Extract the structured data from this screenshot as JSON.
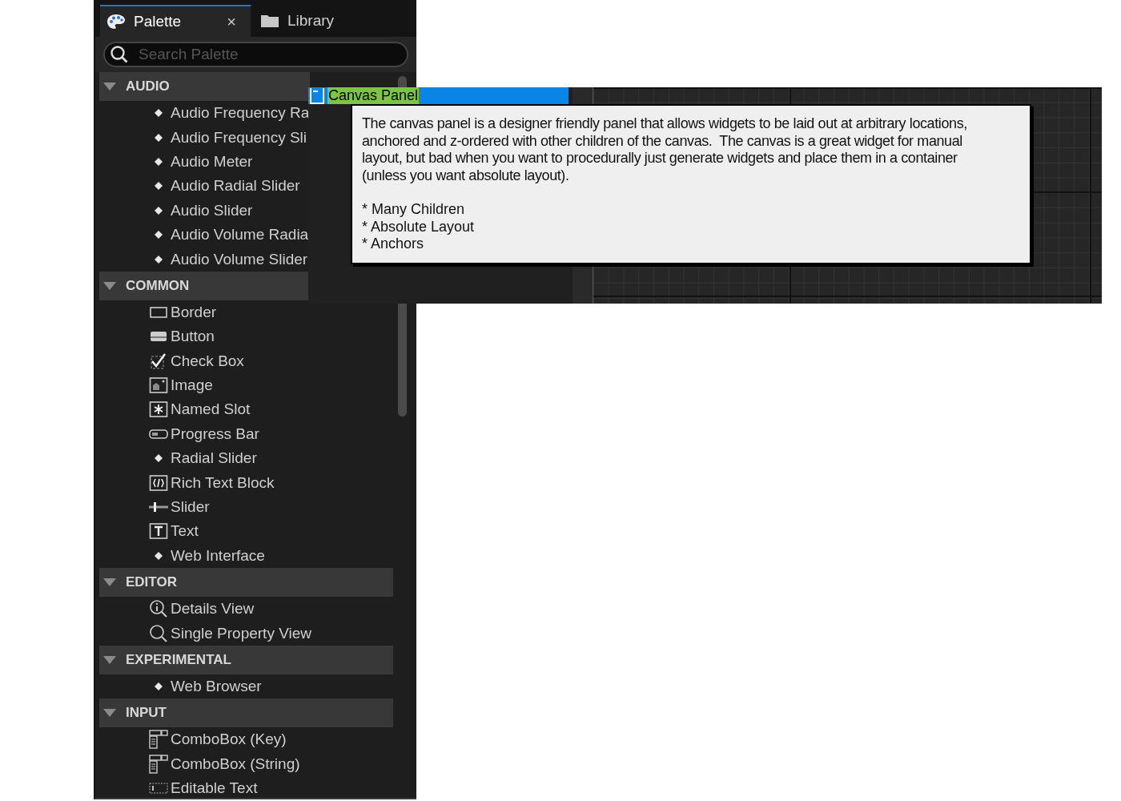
{
  "tabs": [
    {
      "label": "Palette",
      "selected": true,
      "close": "×"
    },
    {
      "label": "Library",
      "selected": false
    }
  ],
  "search": {
    "placeholder": "Search Palette"
  },
  "categories": [
    {
      "title": "AUDIO",
      "expanded": true,
      "items": [
        {
          "label": "Audio Frequency Ra",
          "kind": "bullet"
        },
        {
          "label": "Audio Frequency Sli",
          "kind": "bullet"
        },
        {
          "label": "Audio Meter",
          "kind": "bullet"
        },
        {
          "label": "Audio Radial Slider",
          "kind": "bullet"
        },
        {
          "label": "Audio Slider",
          "kind": "bullet"
        },
        {
          "label": "Audio Volume Radia",
          "kind": "bullet"
        },
        {
          "label": "Audio Volume Slider",
          "kind": "bullet"
        }
      ]
    },
    {
      "title": "COMMON",
      "expanded": true,
      "items": [
        {
          "label": "Border",
          "kind": "border"
        },
        {
          "label": "Button",
          "kind": "button"
        },
        {
          "label": "Check Box",
          "kind": "checkbox"
        },
        {
          "label": "Image",
          "kind": "image"
        },
        {
          "label": "Named Slot",
          "kind": "slot"
        },
        {
          "label": "Progress Bar",
          "kind": "progress"
        },
        {
          "label": "Radial Slider",
          "kind": "bullet"
        },
        {
          "label": "Rich Text Block",
          "kind": "richtext"
        },
        {
          "label": "Slider",
          "kind": "slider"
        },
        {
          "label": "Text",
          "kind": "text"
        },
        {
          "label": "Web Interface",
          "kind": "bullet"
        }
      ]
    },
    {
      "title": "EDITOR",
      "expanded": true,
      "items": [
        {
          "label": "Details View",
          "kind": "details"
        },
        {
          "label": "Single Property View",
          "kind": "search"
        }
      ]
    },
    {
      "title": "EXPERIMENTAL",
      "expanded": true,
      "items": [
        {
          "label": "Web Browser",
          "kind": "bullet"
        }
      ]
    },
    {
      "title": "INPUT",
      "expanded": true,
      "items": [
        {
          "label": "ComboBox (Key)",
          "kind": "combobox"
        },
        {
          "label": "ComboBox (String)",
          "kind": "combobox"
        },
        {
          "label": "Editable Text",
          "kind": "editable"
        }
      ]
    }
  ],
  "drag_item": {
    "label": "Canvas Panel"
  },
  "tooltip": {
    "description": "The canvas panel is a designer friendly panel that allows widgets to be laid out at arbitrary locations, anchored and z-ordered with other children of the canvas.  The canvas is a great widget for manual layout, but bad when you want to procedurally just generate widgets and place them in a container (unless you want absolute layout).",
    "bullets": [
      "* Many Children",
      "* Absolute Layout",
      "* Anchors"
    ]
  }
}
